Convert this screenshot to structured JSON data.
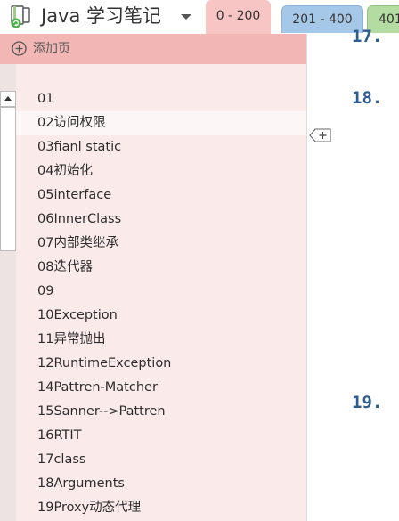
{
  "header": {
    "notebook_title": "Java 学习笔记",
    "icons": {
      "notebook": "notebook-sync-icon",
      "dropdown": "chevron-down-icon"
    },
    "tabs": [
      {
        "label": "0 - 200",
        "active": true,
        "color": "#f7c5c3"
      },
      {
        "label": "201 - 400",
        "active": false,
        "color": "#a6c8e8"
      },
      {
        "label": "401",
        "active": false,
        "color": "#b4dba2"
      }
    ]
  },
  "page_pane": {
    "add_page_label": "添加页",
    "add_page_icon": "plus-circle-icon",
    "pages": [
      {
        "title": "01"
      },
      {
        "title": "02访问权限",
        "selected": true
      },
      {
        "title": "03fianl static"
      },
      {
        "title": "04初始化"
      },
      {
        "title": "05interface"
      },
      {
        "title": "06InnerClass"
      },
      {
        "title": "07内部类继承"
      },
      {
        "title": "08迭代器"
      },
      {
        "title": "09"
      },
      {
        "title": "10Exception"
      },
      {
        "title": "11异常抛出"
      },
      {
        "title": "12RuntimeException"
      },
      {
        "title": "14Pattren-Matcher"
      },
      {
        "title": "15Sanner-->Pattren"
      },
      {
        "title": "16RTIT"
      },
      {
        "title": "17class"
      },
      {
        "title": "18Arguments"
      },
      {
        "title": "19Proxy动态代理"
      }
    ]
  },
  "note": {
    "list_numbers": [
      "17.",
      "18.",
      "19."
    ],
    "expand_handle_icon": "expand-plus-icon"
  },
  "colors": {
    "section_accent": "#f2b7b5",
    "page_pane_bg": "#fbeaea",
    "list_number": "#2e5d91"
  }
}
